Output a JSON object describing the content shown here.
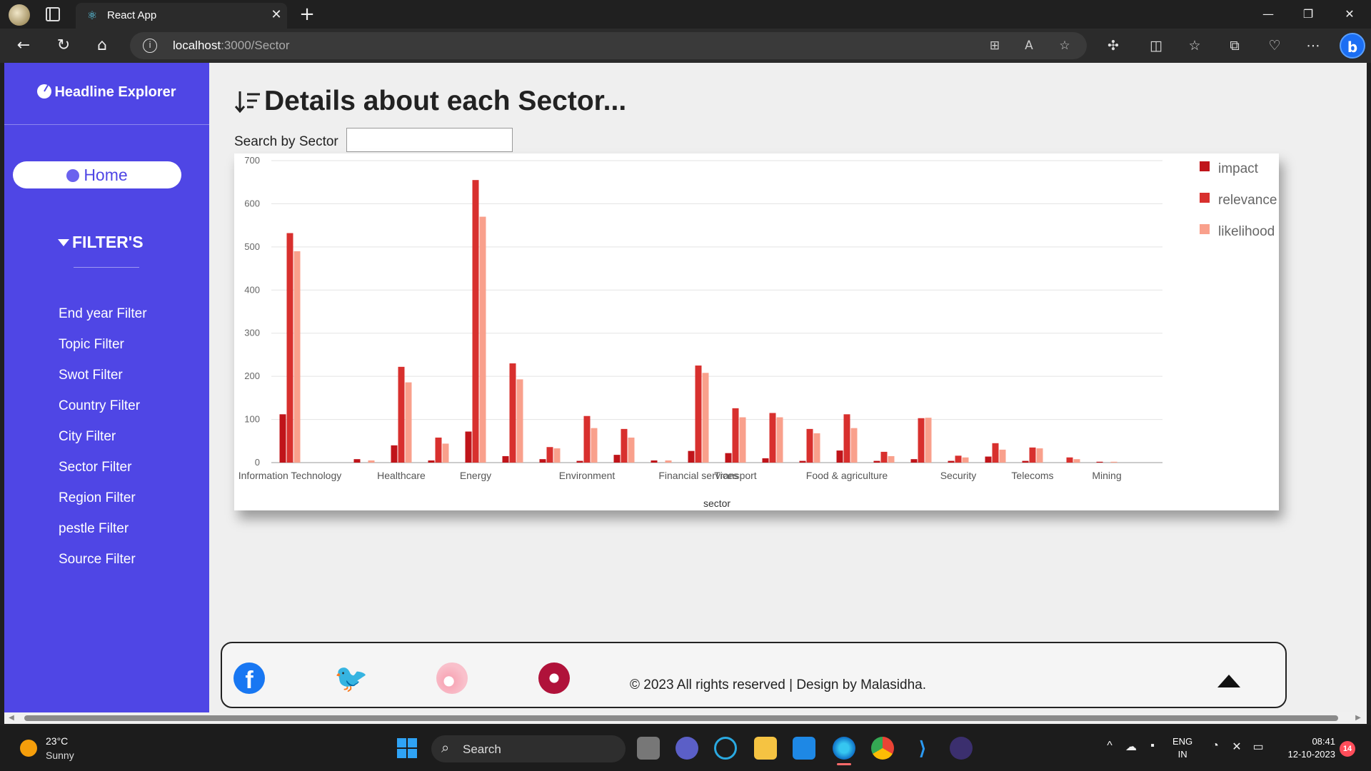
{
  "browser": {
    "tab_title": "React App",
    "url_host": "localhost",
    "url_rest": ":3000/Sector"
  },
  "sidebar": {
    "brand": "Headline Explorer",
    "home_label": "Home",
    "filters_title": "FILTER'S",
    "items": [
      {
        "label": "End year Filter"
      },
      {
        "label": "Topic Filter"
      },
      {
        "label": "Swot Filter"
      },
      {
        "label": "Country Filter"
      },
      {
        "label": "City Filter"
      },
      {
        "label": "Sector Filter"
      },
      {
        "label": "Region Filter"
      },
      {
        "label": "pestle Filter"
      },
      {
        "label": "Source Filter"
      }
    ]
  },
  "main": {
    "title": "Details about each Sector...",
    "search_label": "Search by Sector",
    "search_value": "",
    "search_placeholder": ""
  },
  "chart_data": {
    "type": "bar",
    "xlabel": "sector",
    "ylabel": "",
    "ylim": [
      0,
      700
    ],
    "yticks": [
      0,
      100,
      200,
      300,
      400,
      500,
      600,
      700
    ],
    "grid": true,
    "legend_position": "top-right",
    "category_count": 24,
    "tick_labels": [
      {
        "index": 0,
        "label": "Information Technology"
      },
      {
        "index": 3,
        "label": "Healthcare"
      },
      {
        "index": 5,
        "label": "Energy"
      },
      {
        "index": 8,
        "label": "Environment"
      },
      {
        "index": 11,
        "label": "Financial services"
      },
      {
        "index": 12,
        "label": "Transport"
      },
      {
        "index": 15,
        "label": "Food & agriculture"
      },
      {
        "index": 18,
        "label": "Security"
      },
      {
        "index": 20,
        "label": "Telecoms"
      },
      {
        "index": 22,
        "label": "Mining"
      }
    ],
    "series": [
      {
        "name": "impact",
        "color": "#c0141a",
        "values": [
          112,
          0,
          8,
          40,
          5,
          72,
          15,
          8,
          4,
          18,
          5,
          27,
          22,
          10,
          4,
          28,
          4,
          8,
          4,
          14,
          4,
          0,
          2,
          0
        ]
      },
      {
        "name": "relevance",
        "color": "#d8302e",
        "values": [
          532,
          0,
          0,
          222,
          58,
          655,
          230,
          36,
          108,
          78,
          0,
          225,
          126,
          115,
          78,
          112,
          25,
          103,
          16,
          45,
          35,
          12,
          0,
          0
        ]
      },
      {
        "name": "likelihood",
        "color": "#f9a08c",
        "values": [
          490,
          0,
          5,
          186,
          44,
          570,
          193,
          33,
          80,
          58,
          5,
          208,
          105,
          105,
          68,
          80,
          15,
          104,
          12,
          30,
          33,
          8,
          2,
          0
        ]
      }
    ]
  },
  "footer": {
    "copyright": "© 2023 All rights reserved | Design by Malasidha."
  },
  "taskbar": {
    "temperature": "23°C",
    "weather": "Sunny",
    "search_label": "Search",
    "lang_top": "ENG",
    "lang_bottom": "IN",
    "time": "08:41",
    "date": "12-10-2023",
    "notifications": "14"
  }
}
